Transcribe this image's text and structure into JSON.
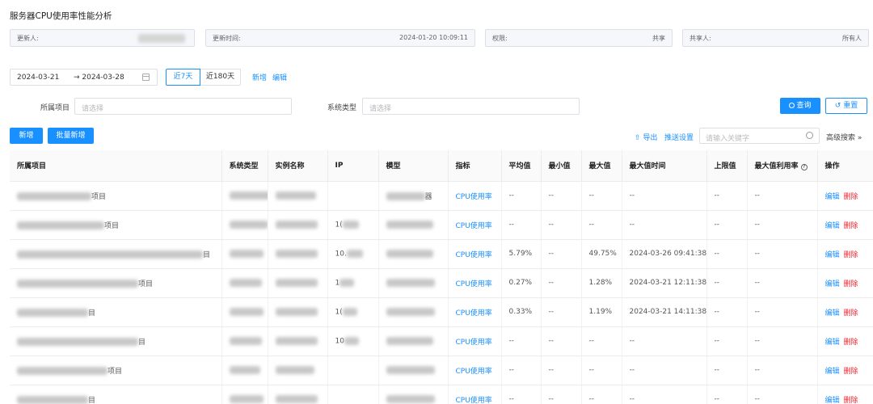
{
  "page_title": "服务器CPU使用率性能分析",
  "meta": {
    "updater_label": "更新人:",
    "update_time_label": "更新时间:",
    "update_time_value": "2024-01-20 10:09:11",
    "permission_label": "权限:",
    "permission_value": "共享",
    "sharer_label": "共享人:",
    "sharer_value": "所有人"
  },
  "filters": {
    "date_start": "2024-03-21",
    "date_end": "→ 2024-03-28",
    "quick_7": "近7天",
    "quick_180": "近180天",
    "add_link": "新增",
    "edit_link": "编辑",
    "project_label": "所属项目",
    "project_placeholder": "请选择",
    "systype_label": "系统类型",
    "systype_placeholder": "请选择",
    "query_button": "查询",
    "reset_button": "重置"
  },
  "toolbar": {
    "add_button": "新增",
    "batch_add_button": "批量新增",
    "export_link": "导出",
    "push_link": "推送设置",
    "search_placeholder": "请输入关键字",
    "advanced_search": "高级搜索"
  },
  "table": {
    "headers": [
      "所属项目",
      "系统类型",
      "实例名称",
      "IP",
      "模型",
      "指标",
      "平均值",
      "最小值",
      "最大值",
      "最大值时间",
      "上限值",
      "最大值利用率",
      "操作"
    ],
    "rows": [
      {
        "project": "项目",
        "ip": "",
        "model_suffix": "器",
        "indicator": "CPU使用率",
        "avg": "--",
        "min": "--",
        "max": "--",
        "max_time": "--",
        "limit": "--",
        "max_util": "--"
      },
      {
        "project": "项目",
        "ip": "1(",
        "model_suffix": "",
        "indicator": "CPU使用率",
        "avg": "--",
        "min": "--",
        "max": "--",
        "max_time": "--",
        "limit": "--",
        "max_util": "--"
      },
      {
        "project": "目",
        "ip": "10.",
        "model_suffix": "",
        "indicator": "CPU使用率",
        "avg": "5.79%",
        "min": "--",
        "max": "49.75%",
        "max_time": "2024-03-26 09:41:38",
        "limit": "--",
        "max_util": "--"
      },
      {
        "project": "项目",
        "ip": "1",
        "model_suffix": "",
        "indicator": "CPU使用率",
        "avg": "0.27%",
        "min": "--",
        "max": "1.28%",
        "max_time": "2024-03-21 12:11:38",
        "limit": "--",
        "max_util": "--"
      },
      {
        "project": "目",
        "ip": "1(",
        "model_suffix": "",
        "indicator": "CPU使用率",
        "avg": "0.33%",
        "min": "--",
        "max": "1.19%",
        "max_time": "2024-03-21 14:11:38",
        "limit": "--",
        "max_util": "--"
      },
      {
        "project": "目",
        "ip": "10",
        "model_suffix": "",
        "indicator": "CPU使用率",
        "avg": "--",
        "min": "--",
        "max": "--",
        "max_time": "--",
        "limit": "--",
        "max_util": "--"
      },
      {
        "project": "项目",
        "ip": "",
        "model_suffix": "",
        "indicator": "CPU使用率",
        "avg": "--",
        "min": "--",
        "max": "--",
        "max_time": "--",
        "limit": "--",
        "max_util": "--"
      },
      {
        "project": "目",
        "ip": "",
        "model_suffix": "",
        "indicator": "CPU使用率",
        "avg": "--",
        "min": "--",
        "max": "--",
        "max_time": "--",
        "limit": "--",
        "max_util": "--"
      }
    ],
    "action_edit": "编辑",
    "action_delete": "删除"
  },
  "colors": {
    "primary": "#1890ff",
    "danger": "#f5222d"
  }
}
